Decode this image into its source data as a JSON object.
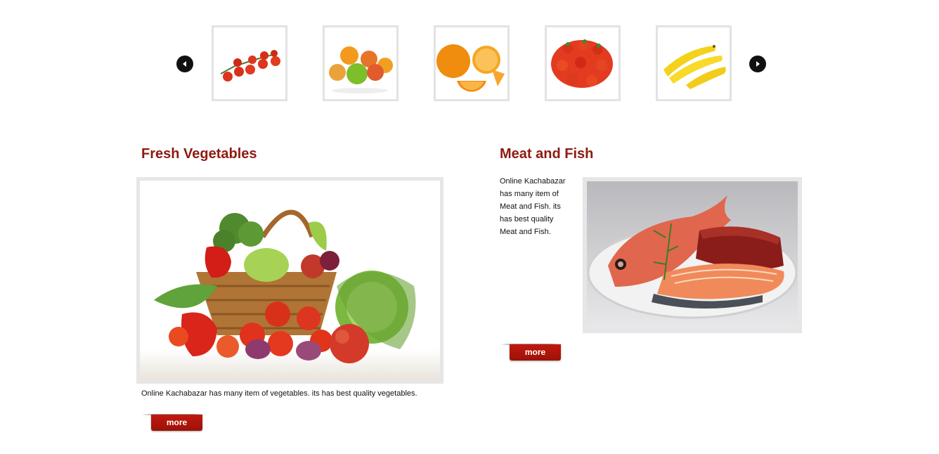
{
  "carousel": {
    "prev_icon": "chevron-left-icon",
    "next_icon": "chevron-right-icon",
    "items": [
      {
        "name": "tomatoes"
      },
      {
        "name": "mixed-fruits"
      },
      {
        "name": "oranges"
      },
      {
        "name": "strawberries"
      },
      {
        "name": "bananas"
      }
    ]
  },
  "vegetables": {
    "title": "Fresh Vegetables",
    "description": "Online Kachabazar has many item of vegetables. its has best quality vegetables.",
    "more_label": "more"
  },
  "meat_fish": {
    "title": "Meat and Fish",
    "description": "Online Kachabazar has many item of Meat and Fish. its has best quality Meat and Fish.",
    "more_label": "more"
  },
  "colors": {
    "title": "#8e1a10",
    "button": "#b3160b",
    "frame": "#e6e6e6"
  }
}
